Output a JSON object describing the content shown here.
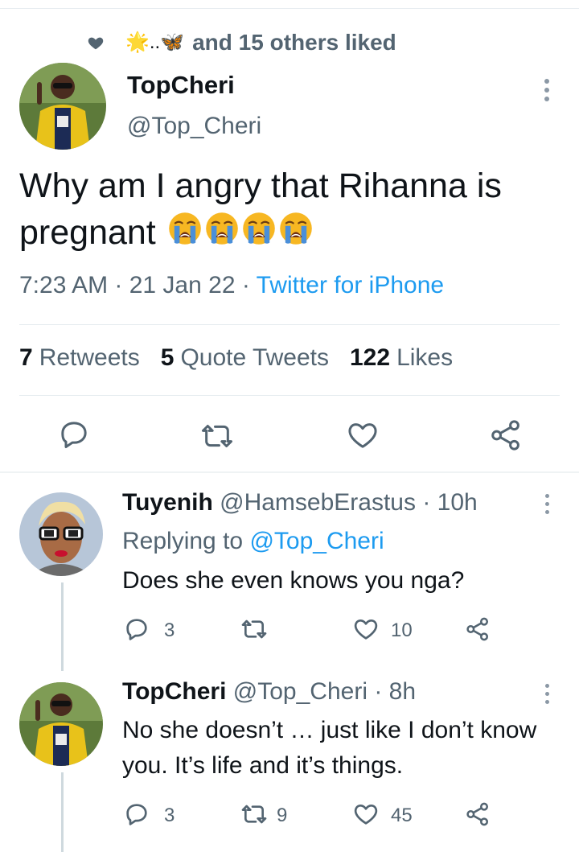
{
  "social_context": {
    "emojis": "🌟..🦋",
    "text": "and 15 others liked"
  },
  "main_tweet": {
    "name": "TopCheri",
    "handle": "@Top_Cheri",
    "text": "Why am I angry that Rihanna is pregnant",
    "emojis": [
      "crying-face",
      "crying-face",
      "crying-face",
      "crying-face"
    ],
    "time": "7:23 AM · 21 Jan 22 · ",
    "source": "Twitter for iPhone",
    "stats": {
      "retweets_count": "7",
      "retweets_label": "Retweets",
      "quotes_count": "5",
      "quotes_label": "Quote Tweets",
      "likes_count": "122",
      "likes_label": "Likes"
    }
  },
  "replies": [
    {
      "name": "Tuyenih",
      "handle": "@HamsebErastus",
      "time": "· 10h",
      "replying_prefix": "Replying to ",
      "replying_to": "@Top_Cheri",
      "text": "Does she even knows you nga?",
      "reply_count": "3",
      "retweet_count": "",
      "like_count": "10"
    },
    {
      "name": "TopCheri",
      "handle": "@Top_Cheri",
      "time": "· 8h",
      "text": "No she doesn’t … just like I don’t know you. It’s life and it’s things.",
      "reply_count": "3",
      "retweet_count": "9",
      "like_count": "45"
    }
  ],
  "colors": {
    "accent": "#1d9bf0",
    "muted": "#536471",
    "text": "#0f1419"
  }
}
